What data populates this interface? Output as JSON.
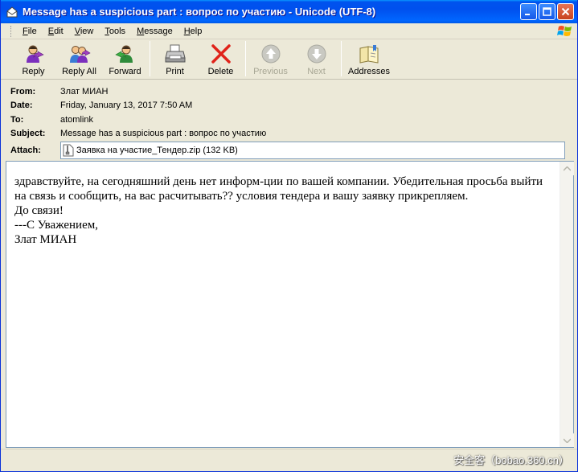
{
  "window": {
    "title": "Message has a suspicious part : вопрос по участию - Unicode (UTF-8)"
  },
  "menu": [
    {
      "key": "F",
      "rest": "ile"
    },
    {
      "key": "E",
      "rest": "dit"
    },
    {
      "key": "V",
      "rest": "iew"
    },
    {
      "key": "T",
      "rest": "ools"
    },
    {
      "key": "M",
      "rest": "essage"
    },
    {
      "key": "H",
      "rest": "elp"
    }
  ],
  "toolbar": {
    "reply": "Reply",
    "reply_all": "Reply All",
    "forward": "Forward",
    "print": "Print",
    "delete": "Delete",
    "previous": "Previous",
    "next": "Next",
    "addresses": "Addresses"
  },
  "headers": {
    "from_label": "From:",
    "from": "Злат МИАН",
    "date_label": "Date:",
    "date": "Friday, January 13, 2017 7:50 AM",
    "to_label": "To:",
    "to": "atomlink",
    "subject_label": "Subject:",
    "subject": "Message has a suspicious part : вопрос по участию",
    "attach_label": "Attach:",
    "attachment": "Заявка на участие_Тендер.zip (132 KB)"
  },
  "body": {
    "text": "здравствуйте, на сегодняшний день нет информ-ции по вашей компании. Убедительная просьба выйти на связь и сообщить, на вас расчитывать?? условия тендера и вашу заявку прикрепляем.\nДо связи!\n---С Уважением,\nЗлат МИАН"
  },
  "watermark": "安全客（bobao.360.cn）",
  "colors": {
    "titlebar": "#0053ee",
    "close_button": "#c8421e",
    "delete_x": "#e0231a"
  }
}
